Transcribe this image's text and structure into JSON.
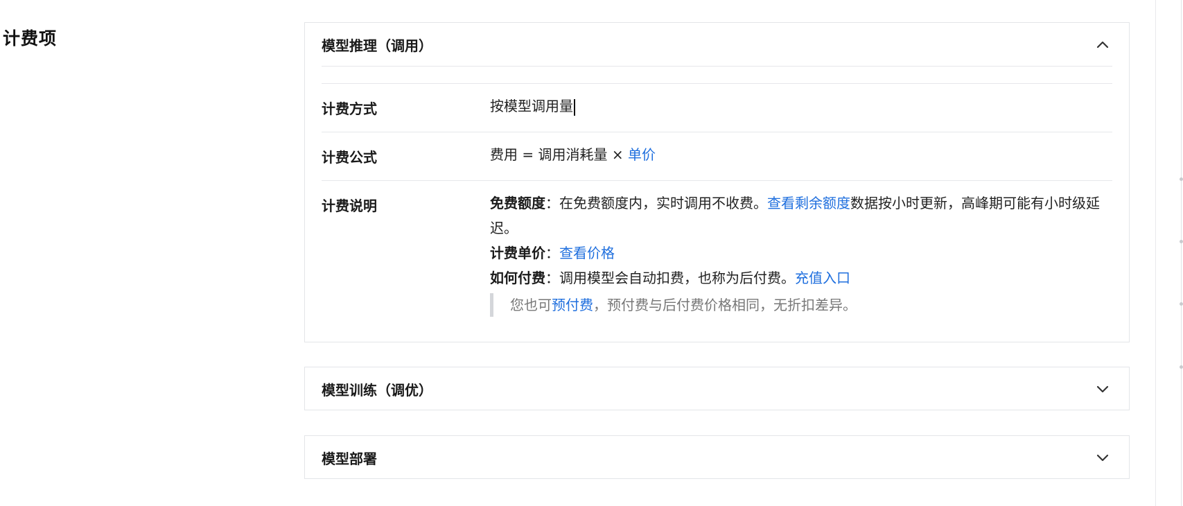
{
  "section": {
    "title": "计费项"
  },
  "panels": [
    {
      "title": "模型推理（调用）",
      "expanded": true,
      "rows": {
        "method": {
          "label": "计费方式",
          "value": "按模型调用量"
        },
        "formula": {
          "label": "计费公式",
          "prefix": "费用 = 调用消耗量 × ",
          "link": "单价"
        },
        "desc": {
          "label": "计费说明",
          "free_label": "免费额度",
          "free_text": "：在免费额度内，实时调用不收费。",
          "free_link": "查看剩余额度",
          "free_text2": "数据按小时更新，高峰期可能有小时级延迟。",
          "price_label": "计费单价",
          "price_sep": "：",
          "price_link": "查看价格",
          "pay_label": "如何付费",
          "pay_text": "：调用模型会自动扣费，也称为后付费。",
          "pay_link": "充值入口",
          "note_prefix": "您也可",
          "note_link": "预付费",
          "note_suffix": "，预付费与后付费价格相同，无折扣差异。"
        }
      }
    },
    {
      "title": "模型训练（调优）",
      "expanded": false
    },
    {
      "title": "模型部署",
      "expanded": false
    }
  ],
  "icons": {
    "expanded": "chevron-up-icon",
    "collapsed": "chevron-down-icon"
  },
  "colors": {
    "link": "#1f6fde",
    "border": "#e3e5e8",
    "note": "#777777"
  }
}
